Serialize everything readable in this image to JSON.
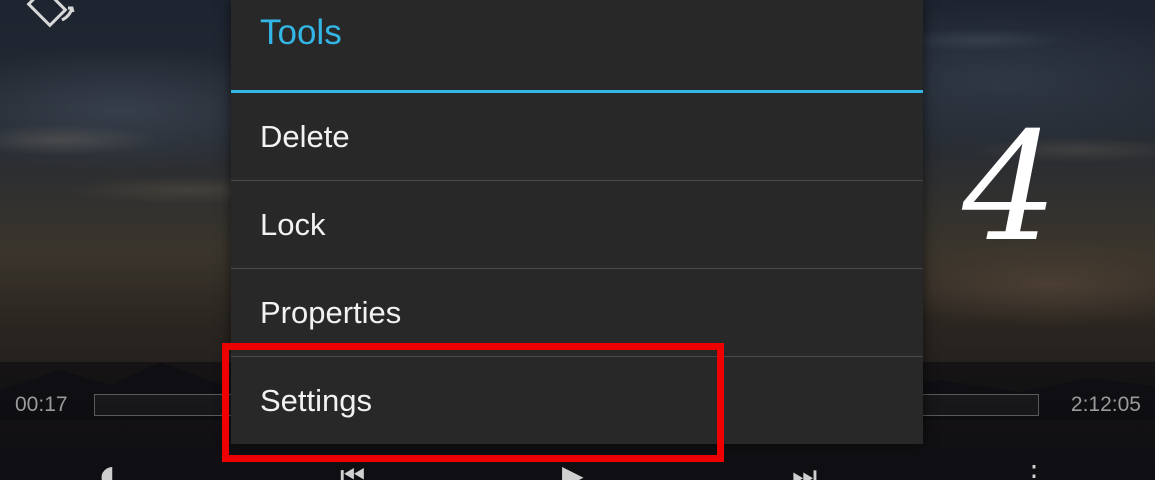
{
  "menu": {
    "title": "Tools",
    "items": [
      {
        "label": "Delete"
      },
      {
        "label": "Lock"
      },
      {
        "label": "Properties"
      },
      {
        "label": "Settings"
      }
    ]
  },
  "player": {
    "elapsed": "00:17",
    "duration": "2:12:05",
    "progress_fraction": 0.0,
    "overlay_number": "4"
  },
  "colors": {
    "accent": "#33b5e5",
    "menu_background": "#282828",
    "highlight": "#ee0000",
    "menu_text": "#f2f2f2"
  },
  "icons": {
    "top_left": "rotate-screen-icon",
    "controls": [
      "previous-icon",
      "play-icon",
      "next-icon"
    ]
  }
}
